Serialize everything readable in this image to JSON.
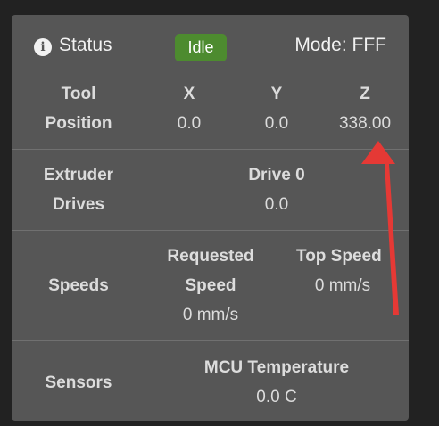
{
  "header": {
    "info_icon": "info-circle-icon",
    "title": "Status",
    "status_badge": "Idle",
    "mode": "Mode: FFF",
    "badge_color": "#4d8b2f"
  },
  "tool_position": {
    "label_line1": "Tool",
    "label_line2": "Position",
    "axes": [
      {
        "name": "X",
        "value": "0.0"
      },
      {
        "name": "Y",
        "value": "0.0"
      },
      {
        "name": "Z",
        "value": "338.00"
      }
    ]
  },
  "extruder_drives": {
    "label_line1": "Extruder",
    "label_line2": "Drives",
    "drive_name": "Drive 0",
    "drive_value": "0.0"
  },
  "speeds": {
    "label": "Speeds",
    "requested_line1": "Requested",
    "requested_line2": "Speed",
    "requested_value": "0 mm/s",
    "top_speed_label": "Top Speed",
    "top_speed_value": "0 mm/s"
  },
  "sensors": {
    "label": "Sensors",
    "mcu_label": "MCU Temperature",
    "mcu_value": "0.0 C"
  },
  "annotation": {
    "arrow_color": "#e53935"
  }
}
